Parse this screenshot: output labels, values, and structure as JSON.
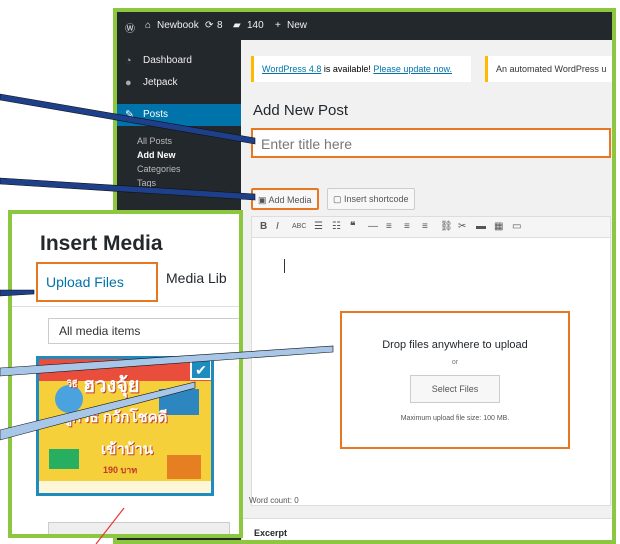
{
  "adminbar": {
    "site_name": "Newbook",
    "updates_count": "8",
    "comments_count": "140",
    "new_label": "New"
  },
  "sidebar": {
    "items": [
      {
        "label": "Dashboard",
        "icon": "dashboard-icon"
      },
      {
        "label": "Jetpack",
        "icon": "jetpack-icon"
      },
      {
        "label": "Posts",
        "icon": "pin-icon"
      }
    ],
    "submenu": [
      "All Posts",
      "Add New",
      "Categories",
      "Tags"
    ]
  },
  "notices": {
    "update_text": " is available! ",
    "update_version": "WordPress 4.8",
    "update_link": "Please update now.",
    "automated_text": "An automated WordPress u"
  },
  "editor": {
    "page_title": "Add New Post",
    "title_placeholder": "Enter title here",
    "add_media_label": "Add Media",
    "insert_shortcode_label": "Insert shortcode",
    "drop_title": "Drop files anywhere to upload",
    "drop_or": "or",
    "select_files_label": "Select Files",
    "max_size": "Maximum upload file size: 100 MB.",
    "word_count": "Word count: 0",
    "excerpt_label": "Excerpt"
  },
  "media_modal": {
    "heading": "Insert Media",
    "upload_tab": "Upload Files",
    "library_tab": "Media Lib",
    "filter_value": "All media items",
    "thumb_text_1": "วิธี",
    "thumb_text_2": "ฮวงจุ้ย",
    "thumb_text_3": "ถูกวิธี กวักโชคดี",
    "thumb_text_4": "เข้าบ้าน",
    "thumb_price": "190 บาท"
  },
  "colors": {
    "highlight_orange": "#e87722",
    "frame_green": "#8dc63f",
    "wp_blue": "#0073aa",
    "arrow_fill": "#1e3f8a"
  }
}
